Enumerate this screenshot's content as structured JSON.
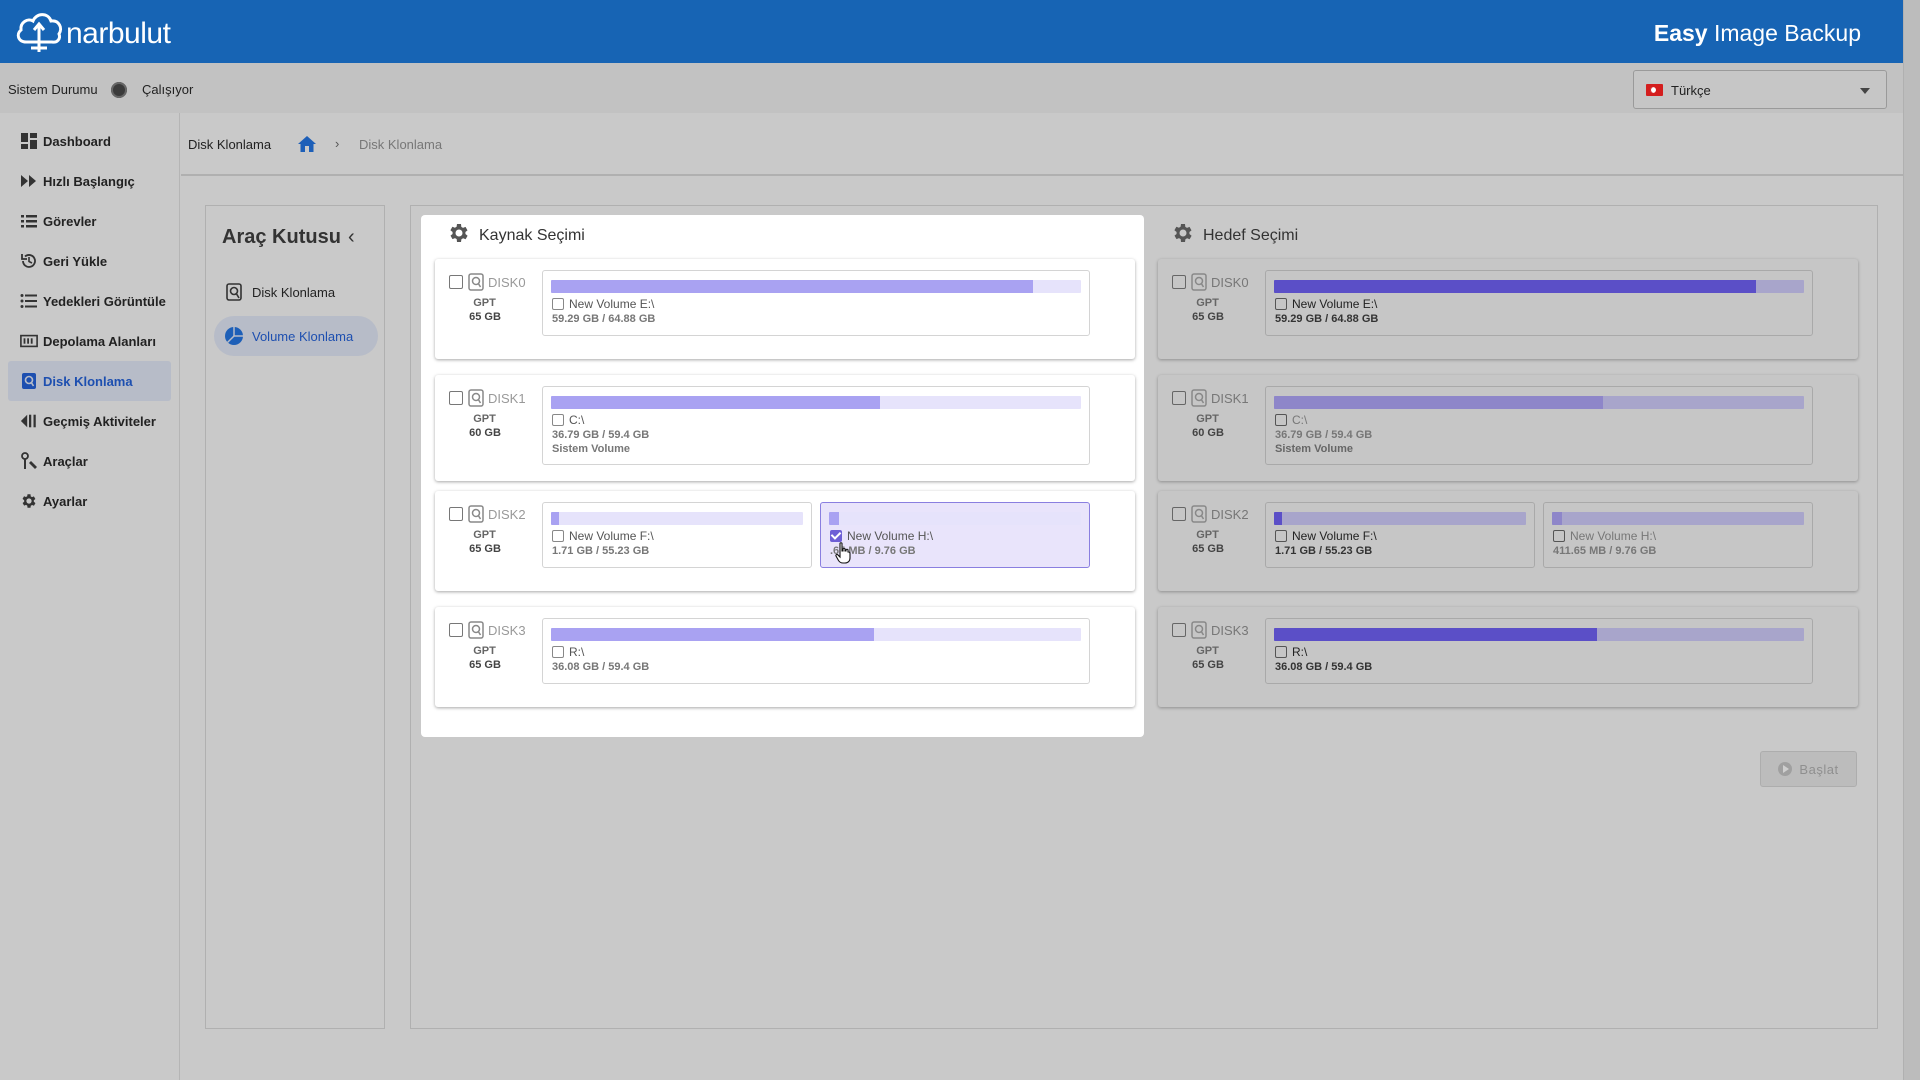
{
  "header": {
    "brand": "narbulut",
    "title_bold": "Easy",
    "title_rest": " Image Backup",
    "brand_color": "#1764b4"
  },
  "status": {
    "label": "Sistem Durumu",
    "value": "Çalışıyor",
    "language": "Türkçe"
  },
  "sidebar": {
    "items": [
      {
        "label": "Dashboard",
        "icon": "dashboard-icon"
      },
      {
        "label": "Hızlı Başlangıç",
        "icon": "fast-forward-icon"
      },
      {
        "label": "Görevler",
        "icon": "list-icon"
      },
      {
        "label": "Geri Yükle",
        "icon": "restore-icon"
      },
      {
        "label": "Yedekleri Görüntüle",
        "icon": "list-view-icon"
      },
      {
        "label": "Depolama Alanları",
        "icon": "storage-icon"
      },
      {
        "label": "Disk Klonlama",
        "icon": "disk-clone-icon",
        "active": true
      },
      {
        "label": "Geçmiş Aktiviteler",
        "icon": "history-icon"
      },
      {
        "label": "Araçlar",
        "icon": "tools-icon"
      },
      {
        "label": "Ayarlar",
        "icon": "gear-icon"
      }
    ]
  },
  "breadcrumb": {
    "title": "Disk Klonlama",
    "sep": "›",
    "current": "Disk Klonlama"
  },
  "toolbox": {
    "title": "Araç Kutusu",
    "collapse": "‹",
    "items": [
      {
        "label": "Disk Klonlama",
        "icon": "disk-icon"
      },
      {
        "label": "Volume Klonlama",
        "icon": "pie-icon",
        "active": true
      }
    ]
  },
  "source": {
    "title": "Kaynak Seçimi",
    "disks": [
      {
        "name": "DISK0",
        "type": "GPT",
        "size": "65 GB",
        "volumes": [
          {
            "name": "New Volume E:\\",
            "usage": "59.29 GB / 64.88 GB",
            "fill": 0.91
          }
        ]
      },
      {
        "name": "DISK1",
        "type": "GPT",
        "size": "60 GB",
        "volumes": [
          {
            "name": "C:\\",
            "usage": "36.79 GB / 59.4 GB",
            "desc": "Sistem Volume",
            "fill": 0.62
          }
        ]
      },
      {
        "name": "DISK2",
        "type": "GPT",
        "size": "65 GB",
        "volumes": [
          {
            "name": "New Volume F:\\",
            "usage": "1.71 GB / 55.23 GB",
            "fill": 0.03
          },
          {
            "name": "New Volume H:\\",
            "usage": ".65 MB / 9.76 GB",
            "fill": 0.04,
            "checked": true,
            "selected": true
          }
        ]
      },
      {
        "name": "DISK3",
        "type": "GPT",
        "size": "65 GB",
        "volumes": [
          {
            "name": "R:\\",
            "usage": "36.08 GB / 59.4 GB",
            "fill": 0.61
          }
        ]
      }
    ]
  },
  "target": {
    "title": "Hedef Seçimi",
    "disks": [
      {
        "name": "DISK0",
        "type": "GPT",
        "size": "65 GB",
        "volumes": [
          {
            "name": "New Volume E:\\",
            "usage": "59.29 GB / 64.88 GB",
            "fill": 0.91
          }
        ]
      },
      {
        "name": "DISK1",
        "type": "GPT",
        "size": "60 GB",
        "volumes": [
          {
            "name": "C:\\",
            "usage": "36.79 GB / 59.4 GB",
            "desc": "Sistem Volume",
            "fill": 0.62,
            "dim": true,
            "muted": true
          }
        ]
      },
      {
        "name": "DISK2",
        "type": "GPT",
        "size": "65 GB",
        "volumes": [
          {
            "name": "New Volume F:\\",
            "usage": "1.71 GB / 55.23 GB",
            "fill": 0.03
          },
          {
            "name": "New Volume H:\\",
            "usage": "411.65 MB / 9.76 GB",
            "fill": 0.04,
            "dim": true,
            "muted": true
          }
        ]
      },
      {
        "name": "DISK3",
        "type": "GPT",
        "size": "65 GB",
        "volumes": [
          {
            "name": "R:\\",
            "usage": "36.08 GB / 59.4 GB",
            "fill": 0.61
          }
        ]
      }
    ]
  },
  "actions": {
    "start": "Başlat"
  }
}
